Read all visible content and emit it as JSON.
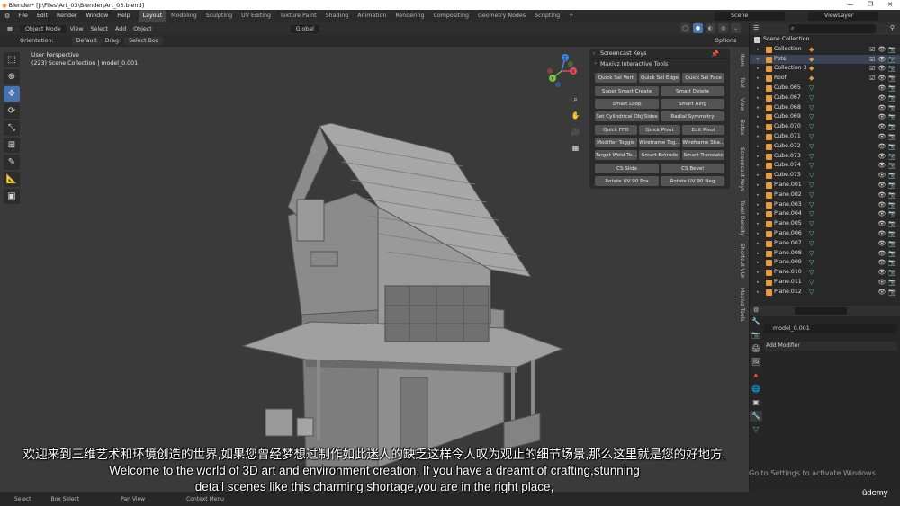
{
  "window": {
    "title": "Blender* [J:\\Files\\Art_03\\Blender\\Art_03.blend]",
    "controls": [
      "—",
      "❐",
      "✕"
    ]
  },
  "menu": [
    "File",
    "Edit",
    "Render",
    "Window",
    "Help"
  ],
  "workspace_tabs": [
    "Layout",
    "Modeling",
    "Sculpting",
    "UV Editing",
    "Texture Paint",
    "Shading",
    "Animation",
    "Rendering",
    "Compositing",
    "Geometry Nodes",
    "Scripting",
    "+"
  ],
  "active_workspace": "Layout",
  "scene": "Scene",
  "view_layer": "ViewLayer",
  "viewport_header": {
    "mode": "Object Mode",
    "items": [
      "View",
      "Select",
      "Add",
      "Object"
    ],
    "transform": "Global"
  },
  "tool_header": {
    "orientation_label": "Orientation:",
    "orientation": "Default",
    "drag_label": "Drag:",
    "drag": "Select Box",
    "options": "Options"
  },
  "viewport": {
    "perspective": "User Perspective",
    "collection_info": "(223) Scene Collection | model_0.001"
  },
  "gizmo": {
    "x": "X",
    "y": "Y",
    "z": "Z"
  },
  "npanel": {
    "screencast": "Screencast Keys",
    "maxivz": "Maxivz Interactive Tools",
    "buttons_three": [
      "Quick Sel Vert",
      "Quick Sel Edge",
      "Quick Sel Face"
    ],
    "buttons_two_a": [
      "Super Smart Create",
      "Smart Delete",
      "Smart Loop",
      "Smart Ring",
      "Set Cylindrical Obj Sides",
      "Radial Symmetry"
    ],
    "buttons_three_b": [
      "Quick FFD",
      "Quick Pivot",
      "Edit Pivot",
      "Modifier Toggle",
      "Wireframe Tog...",
      "Wireframe Sha...",
      "Target Weld To...",
      "Smart Extrude",
      "Smart Translate"
    ],
    "buttons_two_b": [
      "CS Slide",
      "CS Bevel",
      "Rotate UV 90 Pos",
      "Rotate UV 90 Neg"
    ]
  },
  "side_tabs": [
    "Item",
    "Tool",
    "View",
    "Batex",
    "Screencast Keys",
    "Texel Density",
    "Shortcut VUr",
    "Maxivz Tools"
  ],
  "outliner": {
    "root": "Scene Collection",
    "rows": [
      {
        "name": "Collection",
        "type": "collection"
      },
      {
        "name": "Pots",
        "type": "collection"
      },
      {
        "name": "Collection 3",
        "type": "collection"
      },
      {
        "name": "Roof",
        "type": "collection"
      },
      {
        "name": "Cube.065",
        "type": "mesh"
      },
      {
        "name": "Cube.067",
        "type": "mesh"
      },
      {
        "name": "Cube.068",
        "type": "mesh"
      },
      {
        "name": "Cube.069",
        "type": "mesh"
      },
      {
        "name": "Cube.070",
        "type": "mesh"
      },
      {
        "name": "Cube.071",
        "type": "mesh"
      },
      {
        "name": "Cube.072",
        "type": "mesh"
      },
      {
        "name": "Cube.073",
        "type": "mesh"
      },
      {
        "name": "Cube.074",
        "type": "mesh"
      },
      {
        "name": "Cube.075",
        "type": "mesh"
      },
      {
        "name": "Plane.001",
        "type": "mesh"
      },
      {
        "name": "Plane.002",
        "type": "mesh"
      },
      {
        "name": "Plane.003",
        "type": "mesh"
      },
      {
        "name": "Plane.004",
        "type": "mesh"
      },
      {
        "name": "Plane.005",
        "type": "mesh"
      },
      {
        "name": "Plane.006",
        "type": "mesh"
      },
      {
        "name": "Plane.007",
        "type": "mesh"
      },
      {
        "name": "Plane.008",
        "type": "mesh"
      },
      {
        "name": "Plane.009",
        "type": "mesh"
      },
      {
        "name": "Plane.010",
        "type": "mesh"
      },
      {
        "name": "Plane.011",
        "type": "mesh"
      },
      {
        "name": "Plane.012",
        "type": "mesh"
      }
    ]
  },
  "properties": {
    "object": "model_0.001",
    "add_modifier": "Add Modifier"
  },
  "status": [
    "Select",
    "Box Select",
    "Pan View",
    "Context Menu"
  ],
  "subtitles": {
    "cn": "欢迎来到三维艺术和环境创造的世界,如果您曾经梦想过制作如此迷人的缺乏这样令人叹为观止的细节场景,那么这里就是您的好地方,",
    "en1": "Welcome to the world of 3D art and environment creation, If you have a dreamt of crafting,stunning",
    "en2": "detail scenes like this charming shortage,you are in the right place,"
  },
  "watermark": "Go to Settings to activate Windows.",
  "brand": "ûdemy",
  "colors": {
    "accent": "#4772b3",
    "collection": "#e59b3b",
    "mesh": "#5ccf9c"
  }
}
